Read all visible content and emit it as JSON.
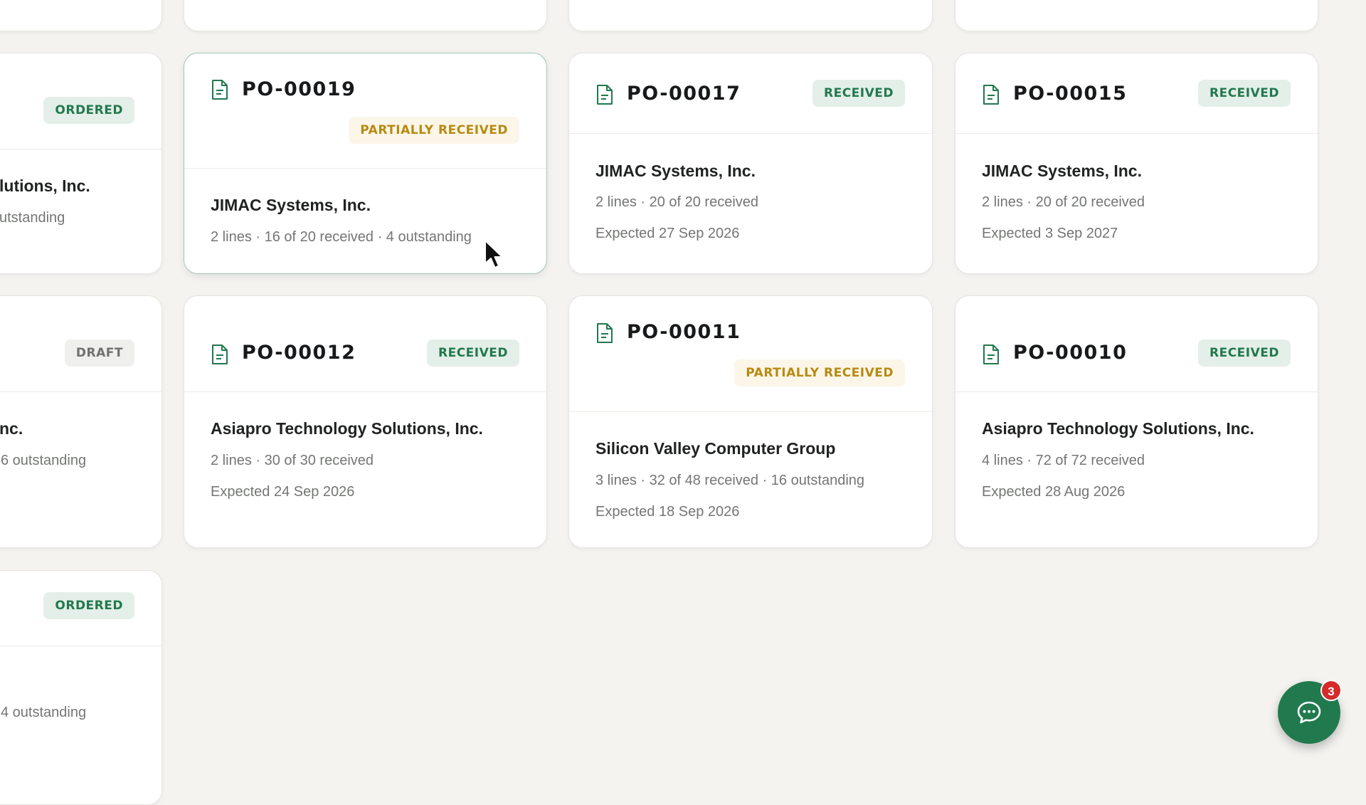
{
  "cards": [
    {
      "po": "PO-00019",
      "status": "PARTIALLY RECEIVED",
      "vendor": "JIMAC Systems, Inc.",
      "summary": "2 lines · 16 of 20 received · 4 outstanding"
    },
    {
      "po": "PO-00017",
      "status": "RECEIVED",
      "vendor": "JIMAC Systems, Inc.",
      "summary": "2 lines · 20 of 20 received",
      "expected": "Expected 27 Sep 2026"
    },
    {
      "po": "PO-00015",
      "status": "RECEIVED",
      "vendor": "JIMAC Systems, Inc.",
      "summary": "2 lines · 20 of 20 received",
      "expected": "Expected 3 Sep 2027"
    },
    {
      "po": "PO-00012",
      "status": "RECEIVED",
      "vendor": "Asiapro Technology Solutions, Inc.",
      "summary": "2 lines · 30 of 30 received",
      "expected": "Expected 24 Sep 2026"
    },
    {
      "po": "PO-00011",
      "status": "PARTIALLY RECEIVED",
      "vendor": "Silicon Valley Computer Group",
      "summary": "3 lines · 32 of 48 received · 16 outstanding",
      "expected": "Expected 18 Sep 2026"
    },
    {
      "po": "PO-00010",
      "status": "RECEIVED",
      "vendor": "Asiapro Technology Solutions, Inc.",
      "summary": "4 lines · 72 of 72 received",
      "expected": "Expected 28 Aug 2026"
    }
  ],
  "partial_cards": [
    {
      "status": "ORDERED",
      "vendor_fragment": "lutions, Inc.",
      "summary_fragment": "utstanding"
    },
    {
      "status": "DRAFT",
      "vendor_fragment": "nc.",
      "summary_fragment": "6 outstanding"
    },
    {
      "status": "ORDERED",
      "summary_fragment": "4 outstanding"
    }
  ],
  "chat": {
    "icon": "chat-bubble-icon",
    "unread_count": "3"
  },
  "colors": {
    "accent": "#207a4e",
    "received": "#23784e",
    "partial": "#b78a12",
    "draft": "#6e716f",
    "notification": "#d52b2b"
  }
}
